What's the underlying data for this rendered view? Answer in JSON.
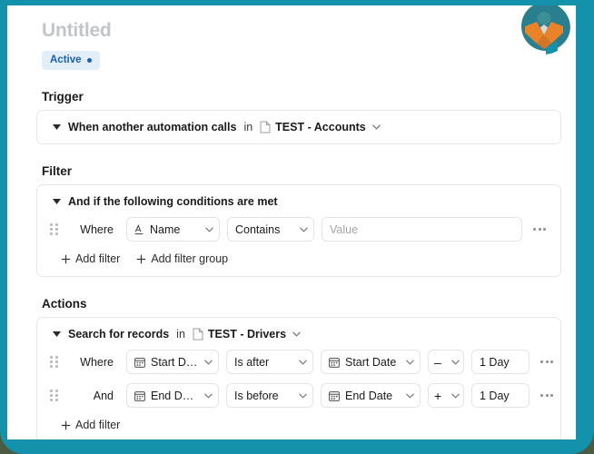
{
  "window": {
    "frame_color_top": "#4a5c42",
    "frame_color_accent": "#1492ab"
  },
  "header": {
    "title": "Untitled",
    "status_badge": {
      "label": "Active",
      "bg": "#e3eefb",
      "fg": "#1a5fb4"
    }
  },
  "trigger": {
    "section_label": "Trigger",
    "summary": "When another automation calls",
    "connector": "in",
    "table": "TEST - Accounts"
  },
  "filter": {
    "section_label": "Filter",
    "summary": "And if the following conditions are met",
    "rows": [
      {
        "conjunction": "Where",
        "field": "Name",
        "field_icon": "text-field-icon",
        "operator": "Contains",
        "value": "",
        "value_placeholder": "Value"
      }
    ],
    "add_filter_label": "Add filter",
    "add_filter_group_label": "Add filter group"
  },
  "actions": {
    "section_label": "Actions",
    "summary": "Search for records",
    "connector": "in",
    "table": "TEST - Drivers",
    "rows": [
      {
        "conjunction": "Where",
        "field": "Start Date (...",
        "field_icon": "calendar-icon",
        "operator": "Is after",
        "compare_field": "Start Date",
        "compare_icon": "calendar-icon",
        "sign": "–",
        "offset": "1 Day"
      },
      {
        "conjunction": "And",
        "field": "End Date (H...",
        "field_icon": "calendar-icon",
        "operator": "Is before",
        "compare_field": "End Date",
        "compare_icon": "calendar-icon",
        "sign": "+",
        "offset": "1 Day"
      }
    ],
    "add_filter_label": "Add filter"
  },
  "logo": {
    "name": "brand-logo",
    "colors": {
      "teal": "#2a7f8e",
      "orange": "#e8832a",
      "dark_teal": "#3d8e96"
    }
  }
}
